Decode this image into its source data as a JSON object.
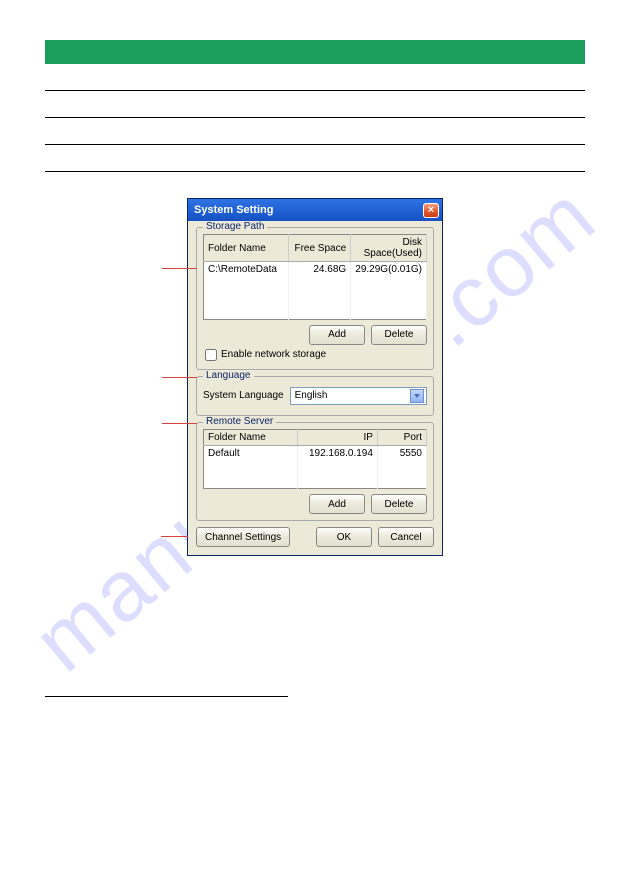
{
  "dialog": {
    "title": "System Setting",
    "close_icon": "×"
  },
  "storage": {
    "legend": "Storage Path",
    "cols": {
      "c1": "Folder Name",
      "c2": "Free Space",
      "c3": "Disk Space(Used)"
    },
    "row": {
      "name": "C:\\RemoteData",
      "free": "24.68G",
      "disk": "29.29G(0.01G)"
    },
    "add_label": "Add",
    "delete_label": "Delete",
    "checkbox_label": "Enable network storage"
  },
  "language": {
    "legend": "Language",
    "label": "System Language",
    "value": "English"
  },
  "remote": {
    "legend": "Remote Server",
    "cols": {
      "c1": "Folder Name",
      "c2": "IP",
      "c3": "Port"
    },
    "row": {
      "name": "Default",
      "ip": "192.168.0.194",
      "port": "5550"
    },
    "add_label": "Add",
    "delete_label": "Delete"
  },
  "bottom": {
    "channel_settings": "Channel Settings",
    "ok": "OK",
    "cancel": "Cancel"
  },
  "watermark": "manualshive.com"
}
